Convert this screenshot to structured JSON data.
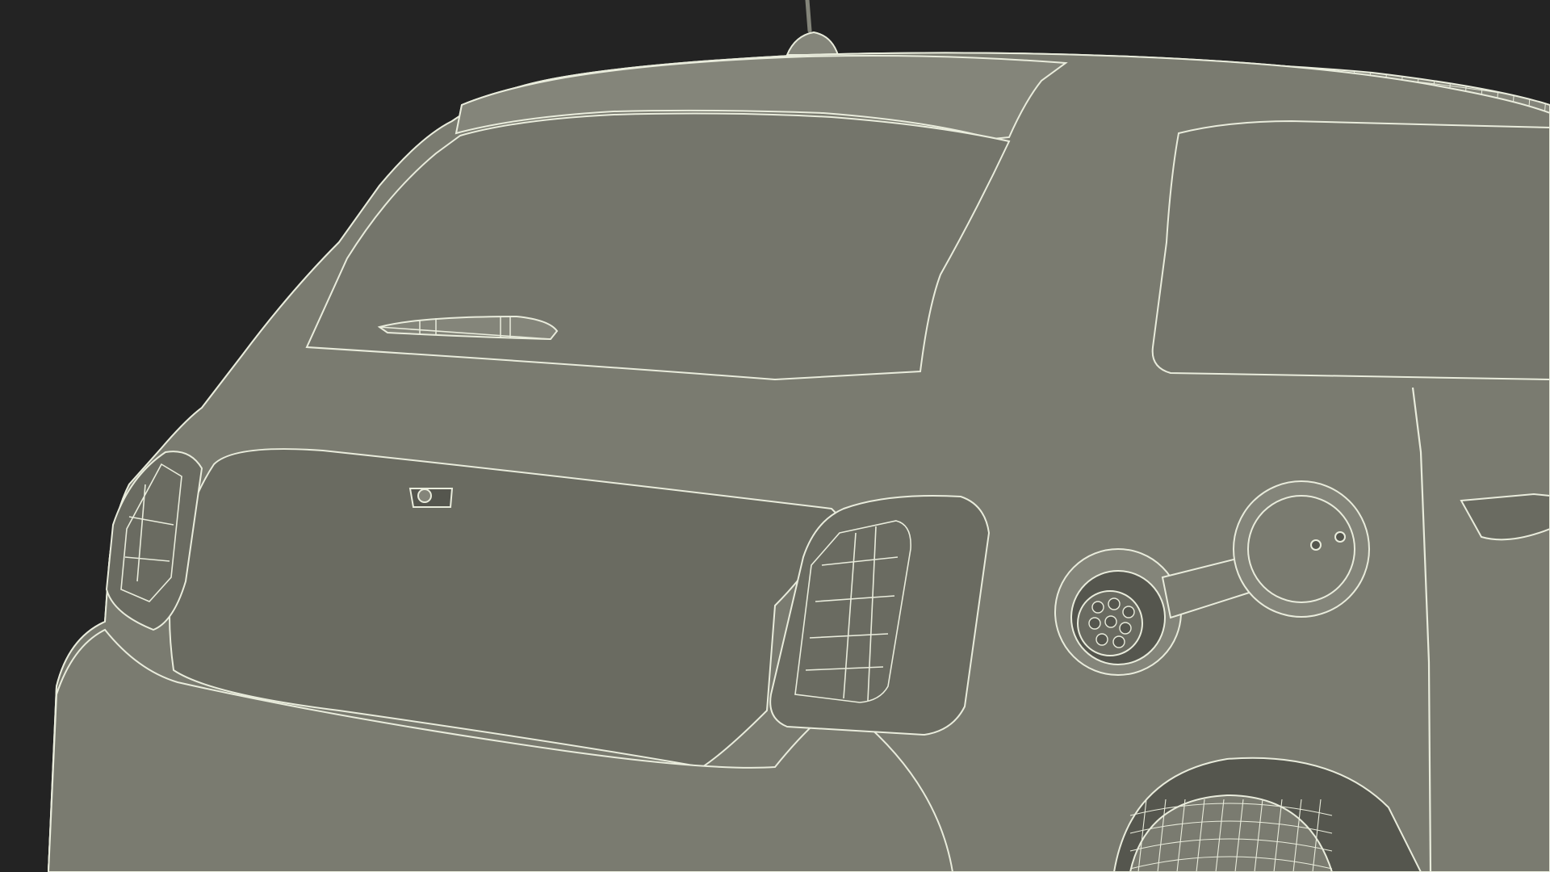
{
  "scene": {
    "subject": "wireframe-render",
    "colors": {
      "background": "#232323",
      "body_fill": "#7a7b70",
      "body_fill_light": "#84857a",
      "body_fill_dark": "#6a6b61",
      "glass_fill": "#74756b",
      "wire": "#e9ecdc",
      "wire_dim": "#cfd2c3",
      "shadow": "#55564e"
    }
  }
}
